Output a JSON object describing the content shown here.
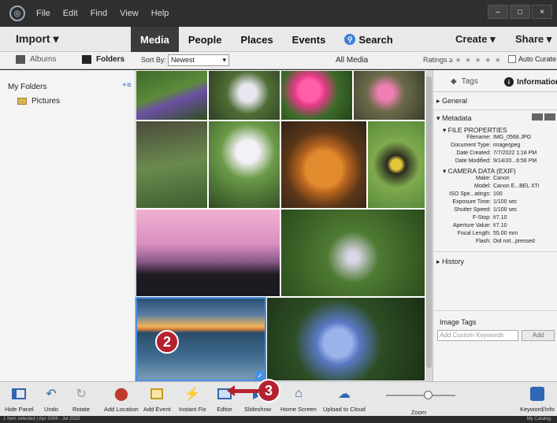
{
  "menu": [
    "File",
    "Edit",
    "Find",
    "View",
    "Help"
  ],
  "window_buttons": [
    "–",
    "□",
    "×"
  ],
  "top_nav": {
    "import": "Import ▾",
    "tabs": [
      "Media",
      "People",
      "Places",
      "Events"
    ],
    "search": "Search",
    "create": "Create ▾",
    "share": "Share ▾"
  },
  "sub_bar": {
    "albums": "Albums",
    "folders": "Folders",
    "sort_by": "Sort By:",
    "sort_value": "Newest",
    "all_media": "All Media",
    "ratings": "Ratings ≥",
    "stars": "★ ★ ★ ★ ★",
    "auto_curate": "Auto Curate"
  },
  "left_panel": {
    "heading": "My Folders",
    "plus": "+≡",
    "folder": "Pictures"
  },
  "right_panel": {
    "tags_tab": "Tags",
    "info_tab": "Information",
    "general": "▸ General",
    "metadata": "▾ Metadata",
    "file_props": "▾ FILE PROPERTIES",
    "camera": "▾ CAMERA DATA (EXIF)",
    "history": "▸ History",
    "file_rows": [
      {
        "k": "Filename:",
        "v": "IMG_0568.JPG"
      },
      {
        "k": "Document Type:",
        "v": "image/jpeg"
      },
      {
        "k": "Date Created:",
        "v": "7/7/2022 1:18 PM"
      },
      {
        "k": "Date Modified:",
        "v": "9/14/20...6:56 PM"
      }
    ],
    "camera_rows": [
      {
        "k": "Make:",
        "v": "Canon"
      },
      {
        "k": "Model:",
        "v": "Canon E...BEL XTi"
      },
      {
        "k": "ISO Spe...atings:",
        "v": "100"
      },
      {
        "k": "Exposure Time:",
        "v": "1/100 sec"
      },
      {
        "k": "Shutter Speed:",
        "v": "1/100 sec"
      },
      {
        "k": "F-Stop:",
        "v": "f/7.10"
      },
      {
        "k": "Aperture Value:",
        "v": "f/7.10"
      },
      {
        "k": "Focal Length:",
        "v": "55.00 mm"
      },
      {
        "k": "Flash:",
        "v": "Did not...pressed"
      }
    ],
    "image_tags": "Image Tags",
    "keyword_placeholder": "Add Custom Keywords",
    "add": "Add"
  },
  "bottom_tools": [
    {
      "label": "Hide Panel",
      "icon": "panel-icon"
    },
    {
      "label": "Undo",
      "icon": "undo-icon"
    },
    {
      "label": "Rotate",
      "icon": "rotate-icon"
    },
    {
      "label": "Add Location",
      "icon": "location-icon"
    },
    {
      "label": "Add Event",
      "icon": "event-icon"
    },
    {
      "label": "Instant Fix",
      "icon": "lightning-icon"
    },
    {
      "label": "Editor",
      "icon": "editor-icon"
    },
    {
      "label": "Slideshow",
      "icon": "slideshow-icon"
    },
    {
      "label": "Home Screen",
      "icon": "home-icon"
    },
    {
      "label": "Upload to Cloud",
      "icon": "cloud-icon"
    },
    {
      "label": "Zoom",
      "icon": "zoom-icon"
    },
    {
      "label": "Keyword/Info",
      "icon": "tag-icon"
    }
  ],
  "status": {
    "left": "1 Item selected | Apr 2008 - Jul 2022",
    "right": "My Catalog"
  },
  "callouts": [
    "2",
    "3"
  ]
}
